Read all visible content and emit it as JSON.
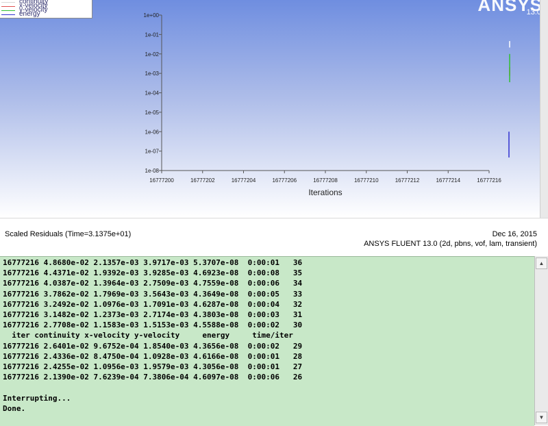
{
  "legend": {
    "items": [
      {
        "label": "continuity",
        "color": "#ffffff"
      },
      {
        "label": "x-velocity",
        "color": "#e05050"
      },
      {
        "label": "y-velocity",
        "color": "#30c030"
      },
      {
        "label": "energy",
        "color": "#3030d0"
      }
    ]
  },
  "logo": {
    "text": "ANSYS",
    "version": "13.0"
  },
  "chart_data": {
    "type": "line",
    "title": "Scaled Residuals  (Time=3.1375e+01)",
    "xlabel": "Iterations",
    "ylabel": "",
    "x_ticks": [
      "16777200",
      "16777202",
      "16777204",
      "16777206",
      "16777208",
      "16777210",
      "16777212",
      "16777214",
      "16777216"
    ],
    "y_ticks": [
      "1e+00",
      "1e-01",
      "1e-02",
      "1e-03",
      "1e-04",
      "1e-05",
      "1e-06",
      "1e-07",
      "1e-08"
    ],
    "xlim": [
      16777200,
      16777216
    ],
    "ylim": [
      1e-08,
      1
    ],
    "y_scale": "log",
    "grid": false,
    "series": [
      {
        "name": "continuity",
        "color": "#ffffff",
        "x": [
          16777216,
          16777216
        ],
        "y": [
          0.046,
          0.0214
        ]
      },
      {
        "name": "x-velocity",
        "color": "#e05050",
        "x": [
          16777216,
          16777216
        ],
        "y": [
          0.0021,
          0.00076
        ]
      },
      {
        "name": "y-velocity",
        "color": "#30c030",
        "x": [
          16777216,
          16777216
        ],
        "y": [
          0.01,
          0.00035
        ]
      },
      {
        "name": "energy",
        "color": "#3030d0",
        "x": [
          16777216,
          16777216
        ],
        "y": [
          1e-06,
          4.7e-08
        ]
      }
    ]
  },
  "info": {
    "title": "Scaled Residuals  (Time=3.1375e+01)",
    "date": "Dec 16, 2015",
    "version": "ANSYS FLUENT 13.0 (2d, pbns, vof, lam, transient)"
  },
  "console": {
    "lines": [
      "16777216 4.8680e-02 2.1357e-03 3.9717e-03 5.3707e-08  0:00:01   36",
      "16777216 4.4371e-02 1.9392e-03 3.9285e-03 4.6923e-08  0:00:08   35",
      "16777216 4.0387e-02 1.3964e-03 2.7509e-03 4.7559e-08  0:00:06   34",
      "16777216 3.7862e-02 1.7969e-03 3.5643e-03 4.3649e-08  0:00:05   33",
      "16777216 3.2492e-02 1.0976e-03 1.7091e-03 4.6287e-08  0:00:04   32",
      "16777216 3.1482e-02 1.2373e-03 2.7174e-03 4.3803e-08  0:00:03   31",
      "16777216 2.7708e-02 1.1583e-03 1.5153e-03 4.5588e-08  0:00:02   30",
      "  iter continuity x-velocity y-velocity     energy     time/iter",
      "16777216 2.6401e-02 9.6752e-04 1.8540e-03 4.3656e-08  0:00:02   29",
      "16777216 2.4336e-02 8.4750e-04 1.0928e-03 4.6166e-08  0:00:01   28",
      "16777216 2.4255e-02 1.0956e-03 1.9579e-03 4.3056e-08  0:00:01   27",
      "16777216 2.1390e-02 7.6239e-04 7.3806e-04 4.6097e-08  0:00:06   26",
      "",
      "Interrupting...",
      "Done."
    ]
  },
  "icons": {
    "scroll_up": "▲",
    "scroll_down": "▼"
  }
}
